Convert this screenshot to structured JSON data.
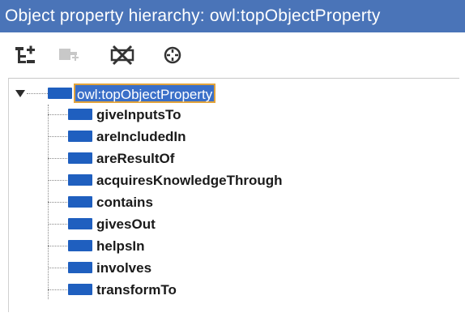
{
  "header": {
    "title": "Object property hierarchy: owl:topObjectProperty"
  },
  "toolbar": {
    "tools": [
      {
        "icon": "add-sub-property-icon"
      },
      {
        "icon": "add-sibling-property-icon"
      },
      {
        "icon": "delete-property-icon"
      },
      {
        "icon": "crosshair-icon"
      }
    ]
  },
  "tree": {
    "root": {
      "label": "owl:topObjectProperty",
      "expanded": true,
      "selected": true
    },
    "children": [
      {
        "label": "giveInputsTo"
      },
      {
        "label": "areIncludedIn"
      },
      {
        "label": "areResultOf"
      },
      {
        "label": "acquiresKnowledgeThrough"
      },
      {
        "label": "contains"
      },
      {
        "label": "givesOut"
      },
      {
        "label": "helpsIn"
      },
      {
        "label": "involves"
      },
      {
        "label": "transformTo"
      }
    ]
  },
  "colors": {
    "titlebar": "#4a74b8",
    "property_icon": "#1f5fbf",
    "selection_border": "#e2a33b"
  }
}
